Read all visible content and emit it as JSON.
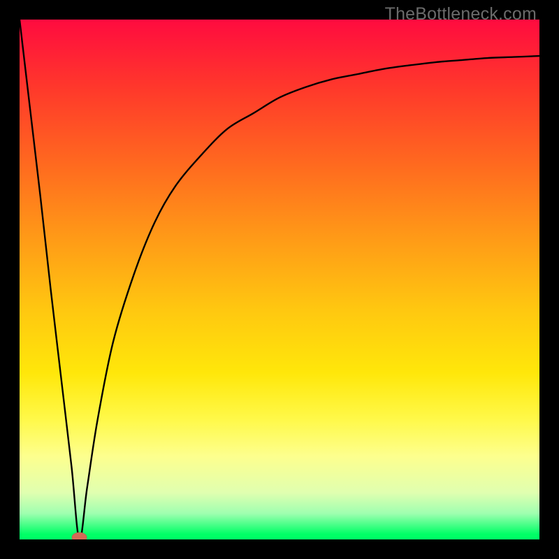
{
  "watermark": "TheBottleneck.com",
  "colors": {
    "background": "#000000",
    "gradient_top": "#ff0b3f",
    "gradient_bottom": "#00ff66",
    "curve": "#000000",
    "marker_fill": "#d46a56",
    "marker_stroke": "#c26050"
  },
  "chart_data": {
    "type": "line",
    "title": "",
    "xlabel": "",
    "ylabel": "",
    "xlim": [
      0,
      1
    ],
    "ylim": [
      0,
      1
    ],
    "note": "Axes are unlabeled in the image; x and y are normalized 0–1. y is visually a deviation/bottleneck metric where 0 (bottom, green) is optimal and 1 (top, red) is worst. The curve has a single sharp minimum near x≈0.12.",
    "series": [
      {
        "name": "curve",
        "x": [
          0.0,
          0.02,
          0.04,
          0.06,
          0.08,
          0.1,
          0.115,
          0.13,
          0.15,
          0.18,
          0.22,
          0.26,
          0.3,
          0.35,
          0.4,
          0.45,
          0.5,
          0.55,
          0.6,
          0.65,
          0.7,
          0.75,
          0.8,
          0.85,
          0.9,
          0.95,
          1.0
        ],
        "y": [
          1.0,
          0.83,
          0.66,
          0.48,
          0.31,
          0.14,
          0.0,
          0.1,
          0.23,
          0.38,
          0.51,
          0.61,
          0.68,
          0.74,
          0.79,
          0.82,
          0.85,
          0.87,
          0.885,
          0.895,
          0.905,
          0.912,
          0.918,
          0.922,
          0.926,
          0.928,
          0.93
        ]
      }
    ],
    "marker": {
      "x": 0.115,
      "y": 0.0,
      "rx": 0.014,
      "ry": 0.009
    }
  }
}
